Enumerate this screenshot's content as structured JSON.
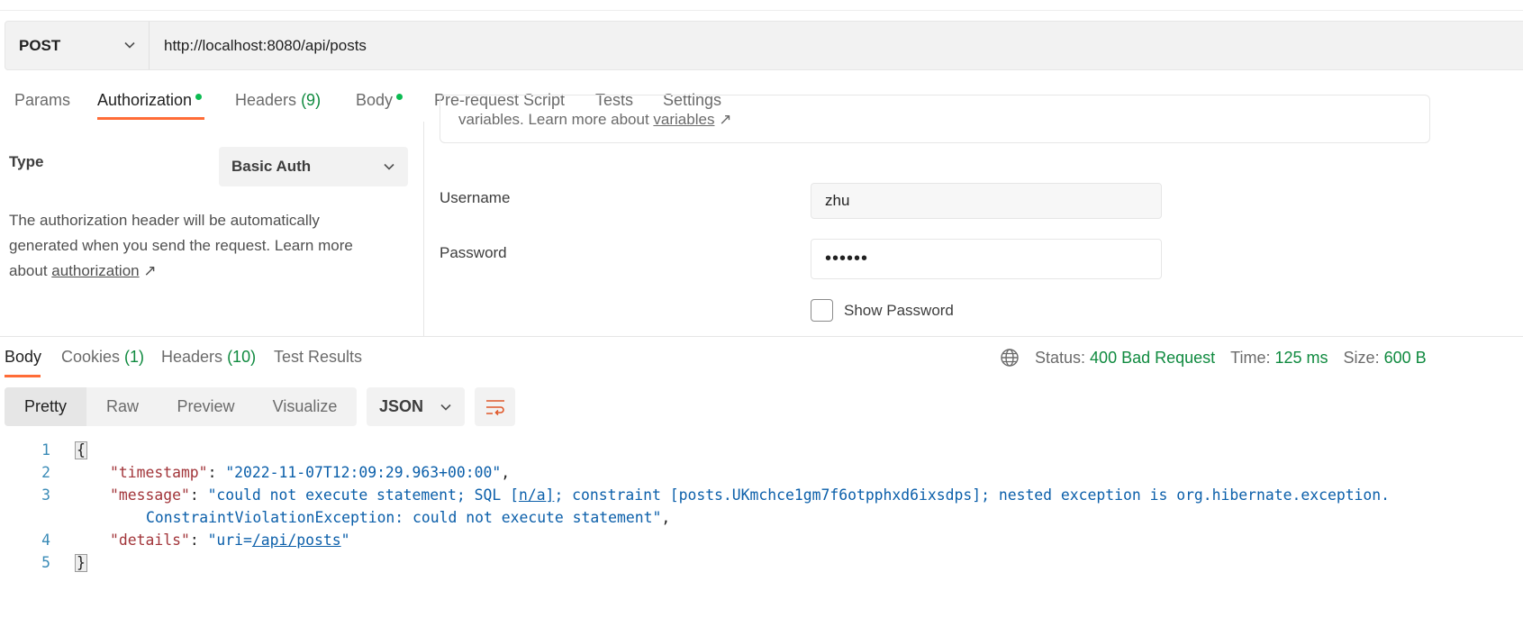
{
  "request": {
    "method": "POST",
    "url": "http://localhost:8080/api/posts"
  },
  "request_tabs": [
    {
      "label": "Params"
    },
    {
      "label": "Authorization",
      "dot": true,
      "active": true
    },
    {
      "label": "Headers",
      "count": "(9)"
    },
    {
      "label": "Body",
      "dot": true
    },
    {
      "label": "Pre-request Script"
    },
    {
      "label": "Tests"
    },
    {
      "label": "Settings"
    }
  ],
  "auth": {
    "type_label": "Type",
    "type_value": "Basic Auth",
    "description": "The authorization header will be automatically generated when you send the request. Learn more about ",
    "description_link": "authorization",
    "link_arrow": "↗",
    "info_prefix": "variables. Learn more about ",
    "info_link": "variables",
    "username_label": "Username",
    "username_value": "zhu",
    "password_label": "Password",
    "password_value": "••••••",
    "show_password_label": "Show Password"
  },
  "response_tabs": [
    {
      "label": "Body",
      "active": true
    },
    {
      "label": "Cookies",
      "count": "(1)"
    },
    {
      "label": "Headers",
      "count": "(10)"
    },
    {
      "label": "Test Results"
    }
  ],
  "response_status": {
    "status_label": "Status:",
    "status_value": "400 Bad Request",
    "time_label": "Time:",
    "time_value": "125 ms",
    "size_label": "Size:",
    "size_value": "600 B"
  },
  "view_modes": [
    "Pretty",
    "Raw",
    "Preview",
    "Visualize"
  ],
  "format": "JSON",
  "code": {
    "line_numbers": [
      "1",
      "2",
      "3",
      "",
      "4",
      "5"
    ],
    "open_brace": "{",
    "close_brace": "}",
    "timestamp_key": "\"timestamp\"",
    "timestamp_value": "\"2022-11-07T12:09:29.963+00:00\"",
    "message_key": "\"message\"",
    "message_value_1": "\"could not execute statement; SQL [",
    "message_value_link": "n/a]",
    "message_value_2": "; constraint [posts.UKmchce1gm7f6otpphxd6ixsdps]; nested exception is org.hibernate.exception.",
    "message_value_3": "ConstraintViolationException: could not execute statement\"",
    "details_key": "\"details\"",
    "details_value_prefix": "\"uri=",
    "details_value_link": "/api/posts",
    "details_value_suffix": "\""
  },
  "colors": {
    "accent": "#ff6c37",
    "success": "#0f8a3f",
    "dot": "#0cbb52",
    "json_key": "#a2353a",
    "json_string": "#0b5faa"
  }
}
